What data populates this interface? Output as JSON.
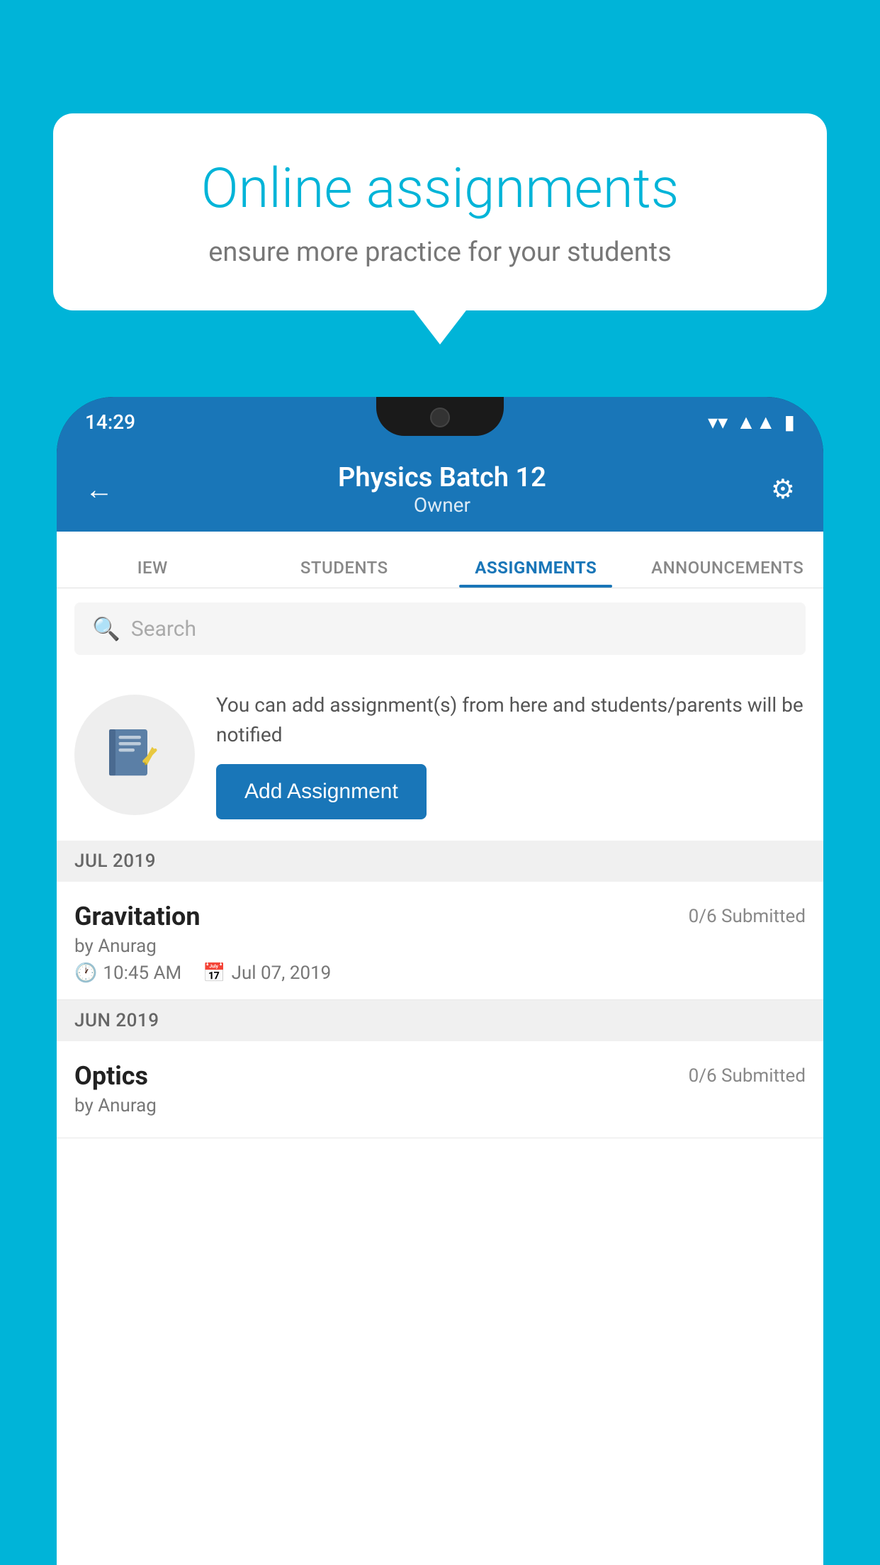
{
  "background_color": "#00B4D8",
  "speech_bubble": {
    "title": "Online assignments",
    "subtitle": "ensure more practice for your students"
  },
  "status_bar": {
    "time": "14:29",
    "wifi": "▾",
    "signal": "▲",
    "battery": "▮"
  },
  "app_header": {
    "title": "Physics Batch 12",
    "subtitle": "Owner",
    "back_label": "←",
    "settings_label": "⚙"
  },
  "tabs": [
    {
      "label": "IEW",
      "active": false
    },
    {
      "label": "STUDENTS",
      "active": false
    },
    {
      "label": "ASSIGNMENTS",
      "active": true
    },
    {
      "label": "ANNOUNCEMENTS",
      "active": false
    }
  ],
  "search": {
    "placeholder": "Search"
  },
  "promo": {
    "text": "You can add assignment(s) from here and students/parents will be notified",
    "button_label": "Add Assignment"
  },
  "sections": [
    {
      "month_label": "JUL 2019",
      "assignments": [
        {
          "name": "Gravitation",
          "submitted": "0/6 Submitted",
          "by": "by Anurag",
          "time": "10:45 AM",
          "date": "Jul 07, 2019"
        }
      ]
    },
    {
      "month_label": "JUN 2019",
      "assignments": [
        {
          "name": "Optics",
          "submitted": "0/6 Submitted",
          "by": "by Anurag",
          "time": "",
          "date": ""
        }
      ]
    }
  ]
}
